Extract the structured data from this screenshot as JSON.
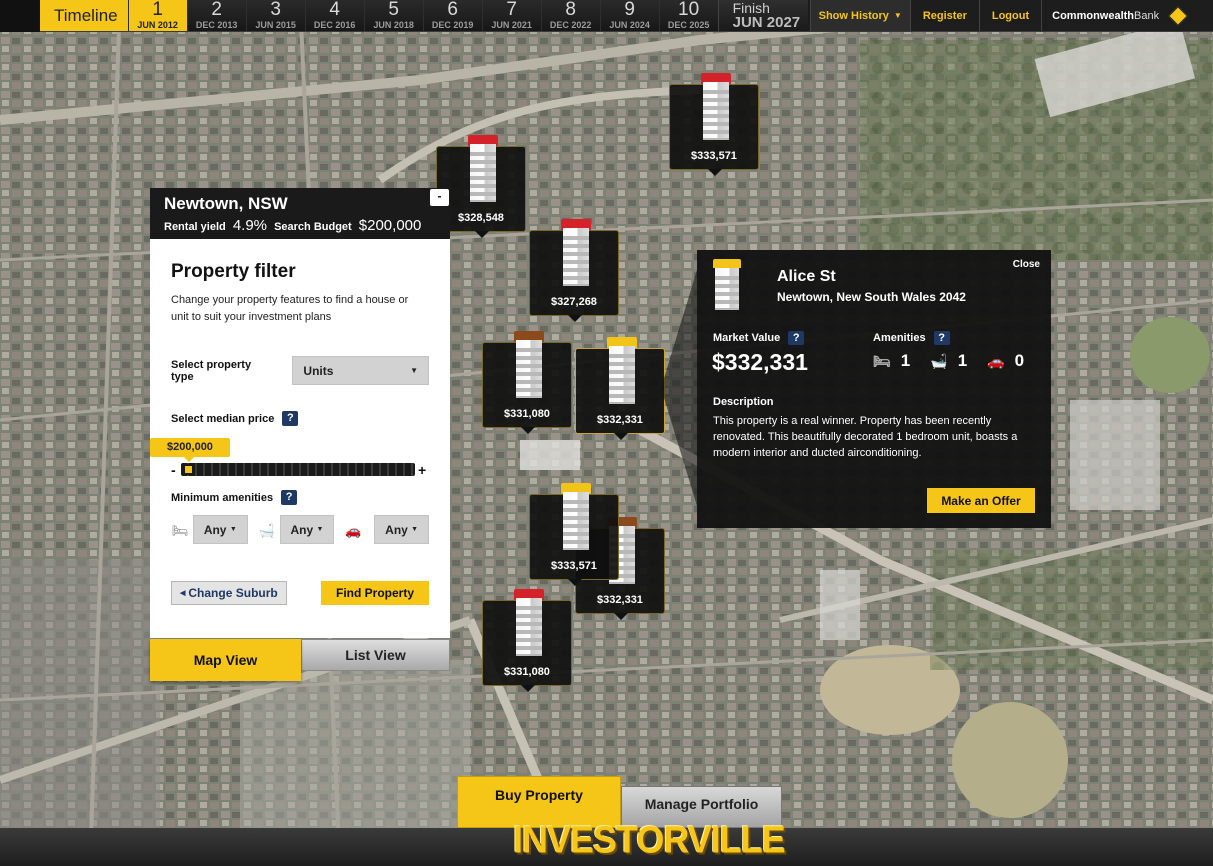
{
  "timeline": {
    "title": "Timeline",
    "steps": [
      {
        "num": "1",
        "date": "JUN 2012",
        "active": true
      },
      {
        "num": "2",
        "date": "DEC 2013"
      },
      {
        "num": "3",
        "date": "JUN 2015"
      },
      {
        "num": "4",
        "date": "DEC 2016"
      },
      {
        "num": "5",
        "date": "JUN 2018"
      },
      {
        "num": "6",
        "date": "DEC 2019"
      },
      {
        "num": "7",
        "date": "JUN 2021"
      },
      {
        "num": "8",
        "date": "DEC 2022"
      },
      {
        "num": "9",
        "date": "JUN 2024"
      },
      {
        "num": "10",
        "date": "DEC 2025"
      }
    ],
    "finish_label": "Finish",
    "finish_date": "JUN 2027"
  },
  "topnav": {
    "show_history": "Show History",
    "register": "Register",
    "logout": "Logout",
    "bank_bold": "Commonwealth",
    "bank_light": "Bank"
  },
  "markers": [
    {
      "price": "$333,571",
      "roof": "red"
    },
    {
      "price": "$328,548",
      "roof": "red"
    },
    {
      "price": "$327,268",
      "roof": "red"
    },
    {
      "price": "$331,080",
      "roof": "brown"
    },
    {
      "price": "$332,331",
      "roof": "yellow"
    },
    {
      "price": "$333,571",
      "roof": "yellow"
    },
    {
      "price": "$332,331",
      "roof": "brown"
    },
    {
      "price": "$331,080",
      "roof": "red"
    }
  ],
  "filter": {
    "suburb": "Newtown, NSW",
    "rental_yield_label": "Rental yield",
    "rental_yield": "4.9%",
    "budget_label": "Search Budget",
    "budget": "$200,000",
    "minimize": "-",
    "title": "Property filter",
    "description": "Change your property features to find a house or unit to suit your investment plans",
    "property_type_label": "Select property type",
    "property_type_value": "Units",
    "median_price_label": "Select median price",
    "median_price_value": "$200,000",
    "minus": "-",
    "plus": "+",
    "amenities_label": "Minimum amenities",
    "bedrooms": "Any",
    "bathrooms": "Any",
    "parking": "Any",
    "change_suburb": "Change Suburb",
    "find_property": "Find Property",
    "help": "?"
  },
  "views": {
    "map": "Map View",
    "list": "List View"
  },
  "detail": {
    "close": "Close",
    "street": "Alice St",
    "suburb": "Newtown, New South Wales 2042",
    "market_value_label": "Market Value",
    "market_value": "$332,331",
    "amenities_label": "Amenities",
    "bedrooms": "1",
    "bathrooms": "1",
    "parking": "0",
    "description_label": "Description",
    "description": "This property is a real winner. Property has been recently renovated. This beautifully decorated 1 bedroom unit, boasts a modern interior and ducted airconditioning.",
    "offer": "Make an Offer",
    "help": "?"
  },
  "bottom": {
    "buy": "Buy Property",
    "manage": "Manage Portfolio",
    "logo": "INVESTORVILLE"
  },
  "colors": {
    "accent": "#f5c518",
    "dark": "#1a1a1a",
    "help_blue": "#1e3a64"
  }
}
